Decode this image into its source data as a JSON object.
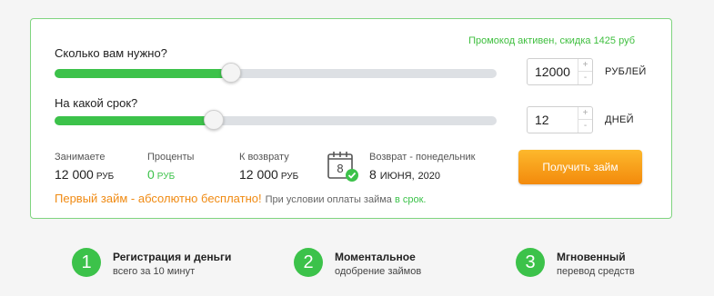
{
  "promo": "Промокод активен, скидка 1425 руб",
  "amount": {
    "label": "Сколько вам нужно?",
    "value": "12000",
    "unit": "РУБЛЕЙ",
    "fraction": 0.4,
    "plus": "+",
    "minus": "-"
  },
  "term": {
    "label": "На какой срок?",
    "value": "12",
    "unit": "ДНЕЙ",
    "fraction": 0.36,
    "plus": "+",
    "minus": "-"
  },
  "summary": {
    "borrow_label": "Занимаете",
    "borrow_value": "12 000",
    "borrow_currency": "РУБ",
    "interest_label": "Проценты",
    "interest_value": "0",
    "interest_currency": "РУБ",
    "total_label": "К возврату",
    "total_value": "12 000",
    "total_currency": "РУБ"
  },
  "return": {
    "calendar_day": "8",
    "label": "Возврат - понедельник",
    "day": "8",
    "month": "ИЮНЯ,",
    "year": "2020"
  },
  "cta": "Получить займ",
  "free_offer": {
    "text": "Первый займ - абсолютно бесплатно!",
    "note": "При условии оплаты займа",
    "note_highlight": "в срок."
  },
  "steps": [
    {
      "number": "1",
      "title": "Регистрация и деньги",
      "subtitle": "всего за 10 минут"
    },
    {
      "number": "2",
      "title": "Моментальное",
      "subtitle": "одобрение займов"
    },
    {
      "number": "3",
      "title": "Мгновенный",
      "subtitle": "перевод средств"
    }
  ],
  "colors": {
    "accent_green": "#3cc24a",
    "button_orange": "#f38a0c",
    "offer_orange": "#f08a12",
    "border_green": "#7fd47f"
  },
  "icons": [
    "calendar-icon",
    "check-badge-icon"
  ]
}
